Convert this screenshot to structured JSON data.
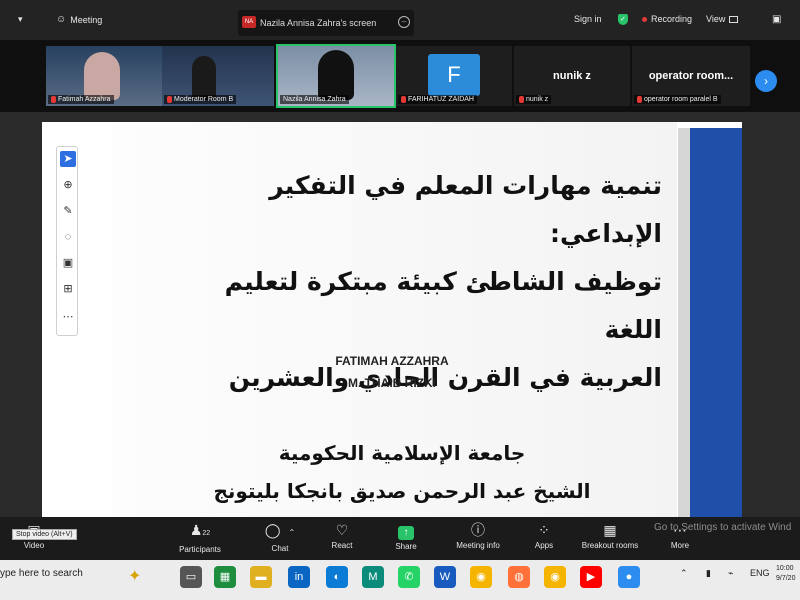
{
  "topbar": {
    "chevron": "▾",
    "meeting_label": "Meeting",
    "share_tab_badge": "NA",
    "share_tab_title": "Nazila Annisa Zahra's screen",
    "sign_in": "Sign in",
    "recording": "Recording",
    "view": "View"
  },
  "gallery": {
    "tiles": [
      {
        "name": "Fatimah Azzahra"
      },
      {
        "name": "Moderator Room B"
      },
      {
        "name": "Nazila Annisa Zahra"
      },
      {
        "name": "FARIHATUZ ZAIDAH",
        "letter": "F"
      },
      {
        "name": "nunik z",
        "display": "nunik z"
      },
      {
        "name": "operator room paralel B",
        "display": "operator room..."
      }
    ],
    "next": "›"
  },
  "slide": {
    "title_lines": [
      "تنمية مهارات المعلم في التفكير الإبداعي:",
      "توظيف الشاطئ كبيئة مبتكرة لتعليم اللغة",
      "العربية في القرن الحادي والعشرين"
    ],
    "authors": [
      "FATIMAH AZZAHRA",
      "M. THAIB RIZKI"
    ],
    "university_lines": [
      "جامعة الإسلامية الحكومية",
      "الشيخ عبد الرحمن صديق بانجكا بليتونج"
    ]
  },
  "annotation_tools": [
    "select-icon",
    "zoom-icon",
    "pen-icon",
    "eraser-icon",
    "capture-icon",
    "stamp-icon",
    "more-icon"
  ],
  "controls": {
    "tooltip": "Stop video (Alt+V)",
    "video": "Video",
    "participants": "Participants",
    "participants_count": "22",
    "chat": "Chat",
    "react": "React",
    "share": "Share",
    "meeting_info": "Meeting info",
    "apps": "Apps",
    "breakout_rooms": "Breakout rooms",
    "more": "More",
    "watermark": "Go to Settings to activate Wind"
  },
  "taskbar": {
    "search": "ype here to search",
    "lang": "ENG",
    "time": "10:00",
    "date": "9/7/20"
  },
  "colors": {
    "accent": "#2d8cf0",
    "slide_blue": "#1f4fa8",
    "recording_red": "#e53935",
    "shield_green": "#29c46a"
  }
}
